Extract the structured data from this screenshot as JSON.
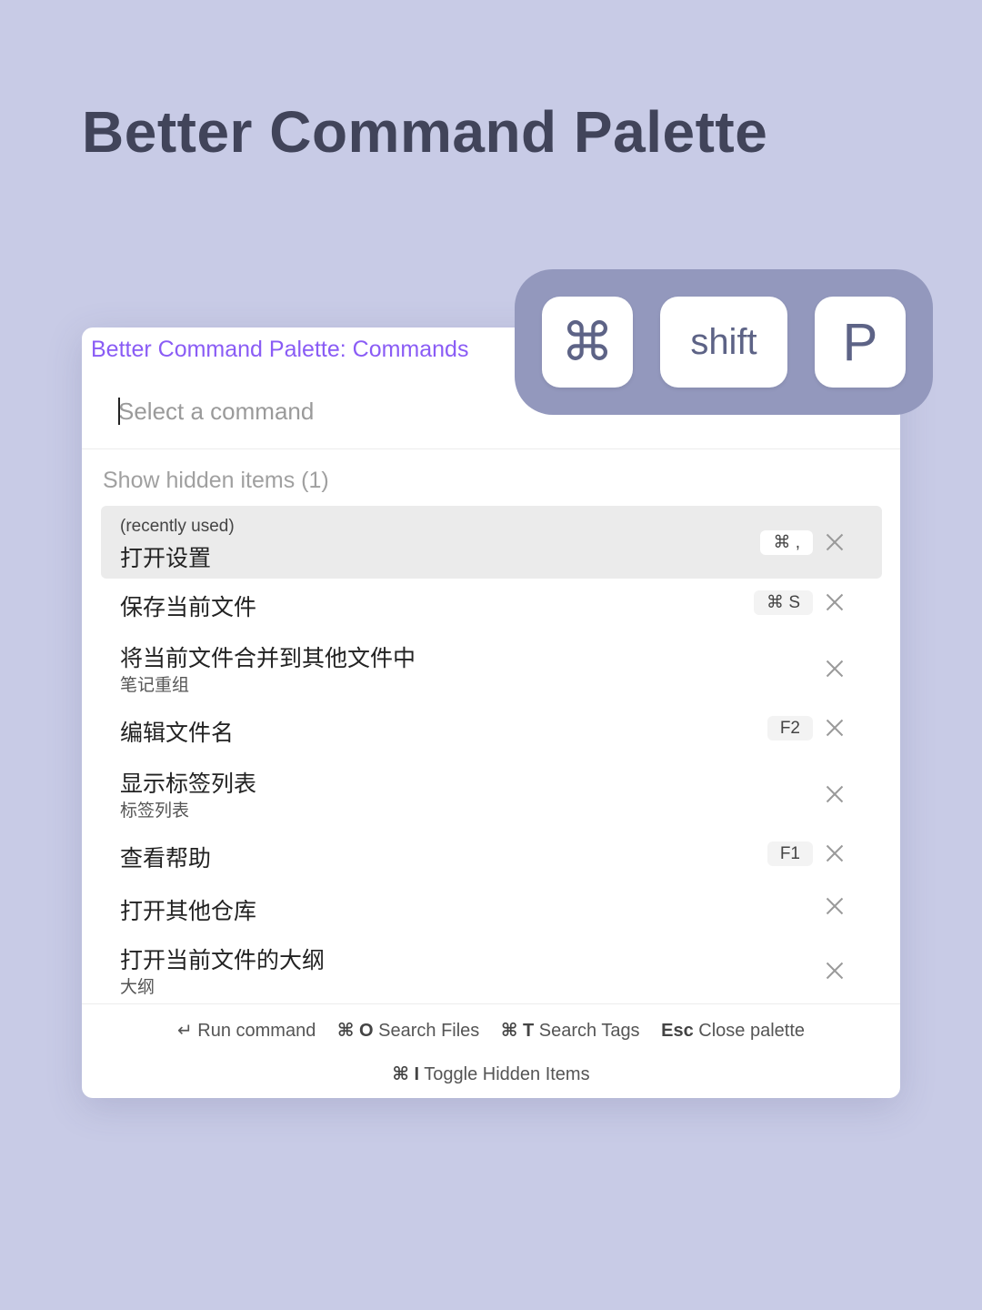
{
  "headline": "Better Command Palette",
  "keys": {
    "cmd": "⌘",
    "shift": "shift",
    "p": "P"
  },
  "palette": {
    "title": "Better Command Palette: Commands",
    "search_placeholder": "Select a command",
    "hidden_toggle": "Show hidden items (1)",
    "items": [
      {
        "note": "(recently used)",
        "label": "打开设置",
        "hotkey": "⌘ ,"
      },
      {
        "label": "保存当前文件",
        "hotkey": "⌘ S"
      },
      {
        "label": "将当前文件合并到其他文件中",
        "sub": "笔记重组"
      },
      {
        "label": "编辑文件名",
        "hotkey": "F2"
      },
      {
        "label": "显示标签列表",
        "sub": "标签列表"
      },
      {
        "label": "查看帮助",
        "hotkey": "F1"
      },
      {
        "label": "打开其他仓库"
      },
      {
        "label": "打开当前文件的大纲",
        "sub": "大纲"
      }
    ],
    "footer": {
      "run": {
        "key": "↵",
        "text": "Run command"
      },
      "files": {
        "key": "⌘ O",
        "text": "Search Files"
      },
      "tags": {
        "key": "⌘ T",
        "text": "Search Tags"
      },
      "close": {
        "key": "Esc",
        "text": "Close palette"
      },
      "hidden": {
        "key": "⌘ I",
        "text": "Toggle Hidden Items"
      }
    }
  },
  "colors": {
    "background": "#c8cbe6",
    "accent": "#8a5cf5",
    "key_cluster": "#9398bd",
    "headline": "#41445a"
  }
}
